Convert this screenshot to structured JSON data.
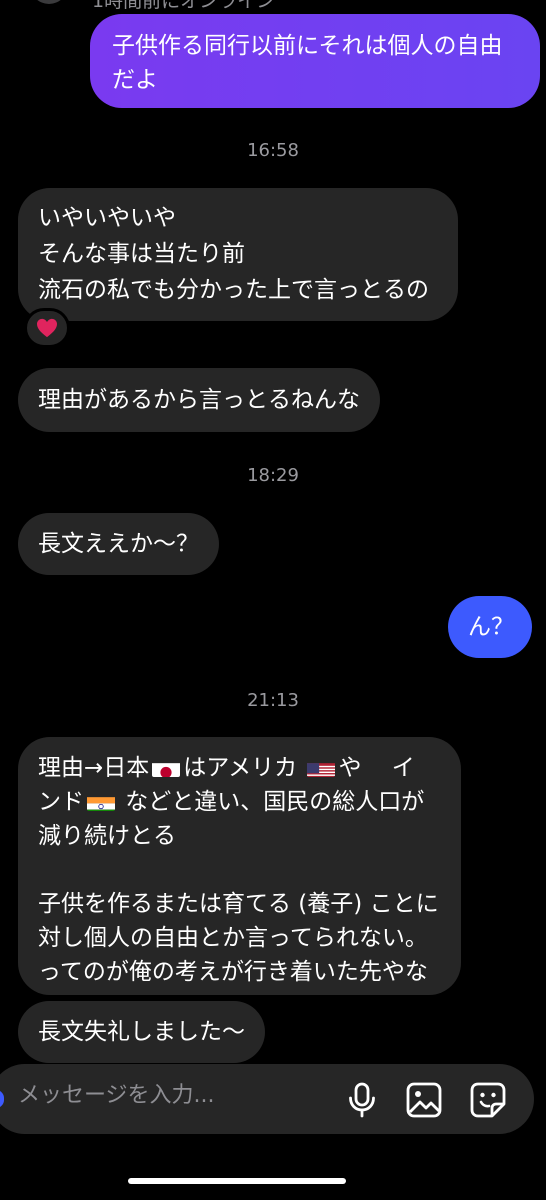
{
  "header": {
    "status": "1時間前にオンライン"
  },
  "messages": [
    {
      "id": "m1",
      "side": "out",
      "text": "子供作る同行以前にそれは個人の自由\nだよ"
    },
    {
      "id": "t1",
      "type": "time",
      "text": "16:58"
    },
    {
      "id": "m2",
      "side": "in",
      "text": "いやいやいや\nそんな事は当たり前\n流石の私でも分かった上で言っとるの",
      "reaction": "heart"
    },
    {
      "id": "m3",
      "side": "in",
      "text": "理由があるから言っとるねんな"
    },
    {
      "id": "t2",
      "type": "time",
      "text": "18:29"
    },
    {
      "id": "m4",
      "side": "in",
      "text": "長文ええか〜？"
    },
    {
      "id": "m5",
      "side": "out",
      "text": "ん？"
    },
    {
      "id": "t3",
      "type": "time",
      "text": "21:13"
    },
    {
      "id": "m6",
      "side": "in",
      "segments": {
        "a": "理由→日本",
        "b": "はアメリカ ",
        "c": "や　 イ",
        "d": "ンド",
        "e": " などと違い、国民の総人口が\n減り続けとる\n\n子供を作るまたは育てる (養子) ことに\n対し個人の自由とか言ってられない。\nってのが俺の考えが行き着いた先やな"
      },
      "flags": [
        "japan-flag",
        "usa-flag",
        "india-flag"
      ]
    },
    {
      "id": "m7",
      "side": "in",
      "text": "長文失礼しました〜"
    }
  ],
  "composer": {
    "placeholder": "メッセージを入力...",
    "icons": [
      "microphone-icon",
      "image-icon",
      "sticker-icon"
    ]
  },
  "colors": {
    "background": "#000000",
    "incoming_bubble": "#262626",
    "outgoing_gradient": [
      "#7a3af0",
      "#6a44f2"
    ],
    "outgoing_blue": "#3d5afe",
    "reaction": "#e0245e"
  }
}
